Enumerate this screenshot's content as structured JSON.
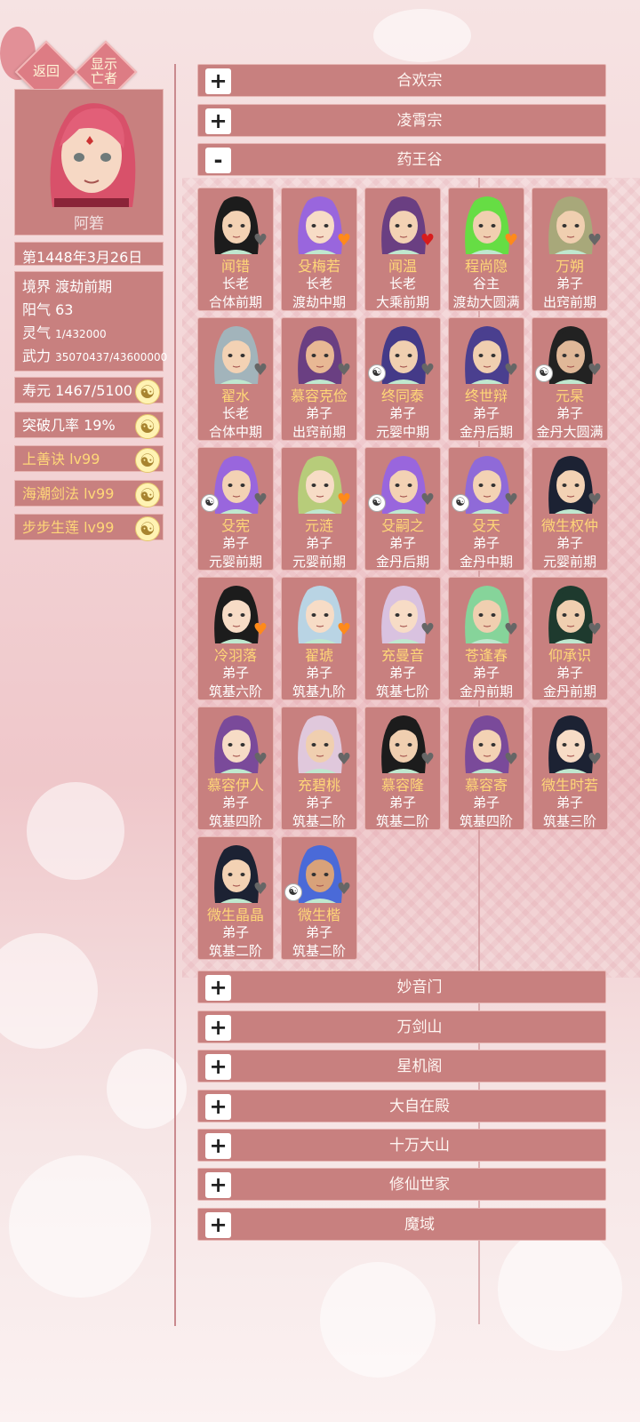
{
  "top_buttons": {
    "back": "返回",
    "show_dead": "显示亡者"
  },
  "player": {
    "name": "阿箬",
    "date": "第1448年3月26日",
    "stats": {
      "realm_label": "境界",
      "realm_value": "渡劫前期",
      "yang_label": "阳气",
      "yang_value": "63",
      "spirit_label": "灵气",
      "spirit_value": "1/432000",
      "force_label": "武力",
      "force_value": "35070437/43600000"
    },
    "pills": [
      {
        "label": "寿元",
        "value": "1467/5100",
        "gold": false
      },
      {
        "label": "突破几率",
        "value": "19%",
        "gold": false
      },
      {
        "label": "上善诀",
        "value": "lv99",
        "gold": true
      },
      {
        "label": "海潮剑法",
        "value": "lv99",
        "gold": true
      },
      {
        "label": "步步生莲",
        "value": "lv99",
        "gold": true
      }
    ]
  },
  "sects_top": [
    {
      "name": "合欢宗",
      "toggle": "+"
    },
    {
      "name": "凌霄宗",
      "toggle": "+"
    },
    {
      "name": "药王谷",
      "toggle": "-"
    }
  ],
  "characters": [
    {
      "name": "闻错",
      "role": "长老",
      "realm": "合体前期",
      "heart": "gray",
      "yin": false,
      "hair": "#1c1c1c",
      "skin": "#f3d2b4"
    },
    {
      "name": "殳梅若",
      "role": "长老",
      "realm": "渡劫中期",
      "heart": "orange",
      "yin": false,
      "hair": "#9966dd",
      "skin": "#f7dcc6"
    },
    {
      "name": "闻温",
      "role": "长老",
      "realm": "大乘前期",
      "heart": "red",
      "yin": false,
      "hair": "#6a3f82",
      "skin": "#f3d2b4"
    },
    {
      "name": "程尚隐",
      "role": "谷主",
      "realm": "渡劫大圆满",
      "heart": "orange",
      "yin": false,
      "hair": "#66dd44",
      "skin": "#f0cfb0"
    },
    {
      "name": "万朔",
      "role": "弟子",
      "realm": "出窍前期",
      "heart": "gray",
      "yin": false,
      "hair": "#a8a87a",
      "skin": "#f0cfb0"
    },
    {
      "name": "翟水",
      "role": "长老",
      "realm": "合体中期",
      "heart": "gray",
      "yin": false,
      "hair": "#a2b4bb",
      "skin": "#f3d2b4"
    },
    {
      "name": "慕容克俭",
      "role": "弟子",
      "realm": "出窍前期",
      "heart": "gray",
      "yin": false,
      "hair": "#6a3f82",
      "skin": "#e8b894"
    },
    {
      "name": "终同泰",
      "role": "弟子",
      "realm": "元婴中期",
      "heart": "gray",
      "yin": true,
      "hair": "#443a88",
      "skin": "#f0cfb0"
    },
    {
      "name": "终世辩",
      "role": "弟子",
      "realm": "金丹后期",
      "heart": "gray",
      "yin": false,
      "hair": "#4a3f8f",
      "skin": "#f0cfb0"
    },
    {
      "name": "元杲",
      "role": "弟子",
      "realm": "金丹大圆满",
      "heart": "gray",
      "yin": true,
      "hair": "#222222",
      "skin": "#e0b898"
    },
    {
      "name": "殳宪",
      "role": "弟子",
      "realm": "元婴前期",
      "heart": "gray",
      "yin": true,
      "hair": "#9966dd",
      "skin": "#f3d2b4"
    },
    {
      "name": "元涟",
      "role": "弟子",
      "realm": "元婴前期",
      "heart": "orange",
      "yin": false,
      "hair": "#b7cc7a",
      "skin": "#f7dcc6"
    },
    {
      "name": "殳嗣之",
      "role": "弟子",
      "realm": "金丹后期",
      "heart": "gray",
      "yin": true,
      "hair": "#9966dd",
      "skin": "#f3d2b4"
    },
    {
      "name": "殳天",
      "role": "弟子",
      "realm": "金丹中期",
      "heart": "gray",
      "yin": true,
      "hair": "#8f6ad8",
      "skin": "#f3d2b4"
    },
    {
      "name": "微生权仲",
      "role": "弟子",
      "realm": "元婴前期",
      "heart": "gray",
      "yin": false,
      "hair": "#1c2233",
      "skin": "#f3d2b4"
    },
    {
      "name": "冷羽落",
      "role": "弟子",
      "realm": "筑基六阶",
      "heart": "orange",
      "yin": false,
      "hair": "#1c1c1c",
      "skin": "#f7dcc6"
    },
    {
      "name": "翟琥",
      "role": "弟子",
      "realm": "筑基九阶",
      "heart": "orange",
      "yin": false,
      "hair": "#b9d4e4",
      "skin": "#f7dcc6"
    },
    {
      "name": "充曼音",
      "role": "弟子",
      "realm": "筑基七阶",
      "heart": "gray",
      "yin": false,
      "hair": "#d9c2e0",
      "skin": "#f7dcc6"
    },
    {
      "name": "苍逢春",
      "role": "弟子",
      "realm": "金丹前期",
      "heart": "gray",
      "yin": false,
      "hair": "#86d49a",
      "skin": "#f0cfb0"
    },
    {
      "name": "仰承识",
      "role": "弟子",
      "realm": "金丹前期",
      "heart": "gray",
      "yin": false,
      "hair": "#1e3a2e",
      "skin": "#f0cfb0"
    },
    {
      "name": "慕容伊人",
      "role": "弟子",
      "realm": "筑基四阶",
      "heart": "gray",
      "yin": false,
      "hair": "#7a4a9a",
      "skin": "#f7dcc6"
    },
    {
      "name": "充碧桃",
      "role": "弟子",
      "realm": "筑基二阶",
      "heart": "gray",
      "yin": false,
      "hair": "#e0c8dc",
      "skin": "#f0cfb0"
    },
    {
      "name": "慕容隆",
      "role": "弟子",
      "realm": "筑基二阶",
      "heart": "gray",
      "yin": false,
      "hair": "#1c1c1c",
      "skin": "#f0cfb0"
    },
    {
      "name": "慕容寄",
      "role": "弟子",
      "realm": "筑基四阶",
      "heart": "gray",
      "yin": false,
      "hair": "#7a4a9a",
      "skin": "#f3d2b4"
    },
    {
      "name": "微生时若",
      "role": "弟子",
      "realm": "筑基三阶",
      "heart": "gray",
      "yin": false,
      "hair": "#1c2233",
      "skin": "#f7dcc6"
    },
    {
      "name": "微生晶晶",
      "role": "弟子",
      "realm": "筑基二阶",
      "heart": "gray",
      "yin": false,
      "hair": "#1c2233",
      "skin": "#f3d2b4"
    },
    {
      "name": "微生楷",
      "role": "弟子",
      "realm": "筑基二阶",
      "heart": "gray",
      "yin": true,
      "hair": "#4a6ad8",
      "skin": "#d8a27a"
    }
  ],
  "sects_bottom": [
    {
      "name": "妙音门",
      "toggle": "+"
    },
    {
      "name": "万剑山",
      "toggle": "+"
    },
    {
      "name": "星机阁",
      "toggle": "+"
    },
    {
      "name": "大自在殿",
      "toggle": "+"
    },
    {
      "name": "十万大山",
      "toggle": "+"
    },
    {
      "name": "修仙世家",
      "toggle": "+"
    },
    {
      "name": "魔域",
      "toggle": "+"
    }
  ],
  "colors": {
    "panel": "#c8807f",
    "gold_text": "#ffd778",
    "heart_red": "#d81c1c",
    "heart_orange": "#ff8a1a",
    "heart_gray": "#666666"
  }
}
